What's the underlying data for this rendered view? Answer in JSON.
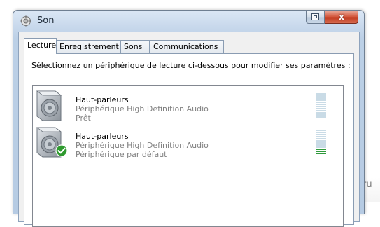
{
  "window": {
    "title": "Son",
    "close_label": "x"
  },
  "tabs": [
    {
      "label": "Lecture",
      "active": true
    },
    {
      "label": "Enregistrement",
      "active": false
    },
    {
      "label": "Sons",
      "active": false
    },
    {
      "label": "Communications",
      "active": false
    }
  ],
  "panel": {
    "instruction": "Sélectionnez un périphérique de lecture ci-dessous pour modifier ses paramètres :"
  },
  "devices": [
    {
      "name": "Haut-parleurs",
      "description": "Périphérique High Definition Audio",
      "status": "Prêt",
      "is_default": false,
      "meter_level": 0
    },
    {
      "name": "Haut-parleurs",
      "description": "Périphérique High Definition Audio",
      "status": "Périphérique par défaut",
      "is_default": true,
      "meter_level": 3
    }
  ],
  "background_text": "ru",
  "colors": {
    "meter_active": "#2f9a3c",
    "meter_idle": "#c9dbe6",
    "default_check": "#2e9a2e",
    "close_button": "#c13a1f"
  },
  "icons": {
    "app": "speaker-gear-icon",
    "help": "help-icon",
    "close": "close-icon",
    "device": "speaker-icon",
    "default_badge": "checkmark-icon"
  }
}
